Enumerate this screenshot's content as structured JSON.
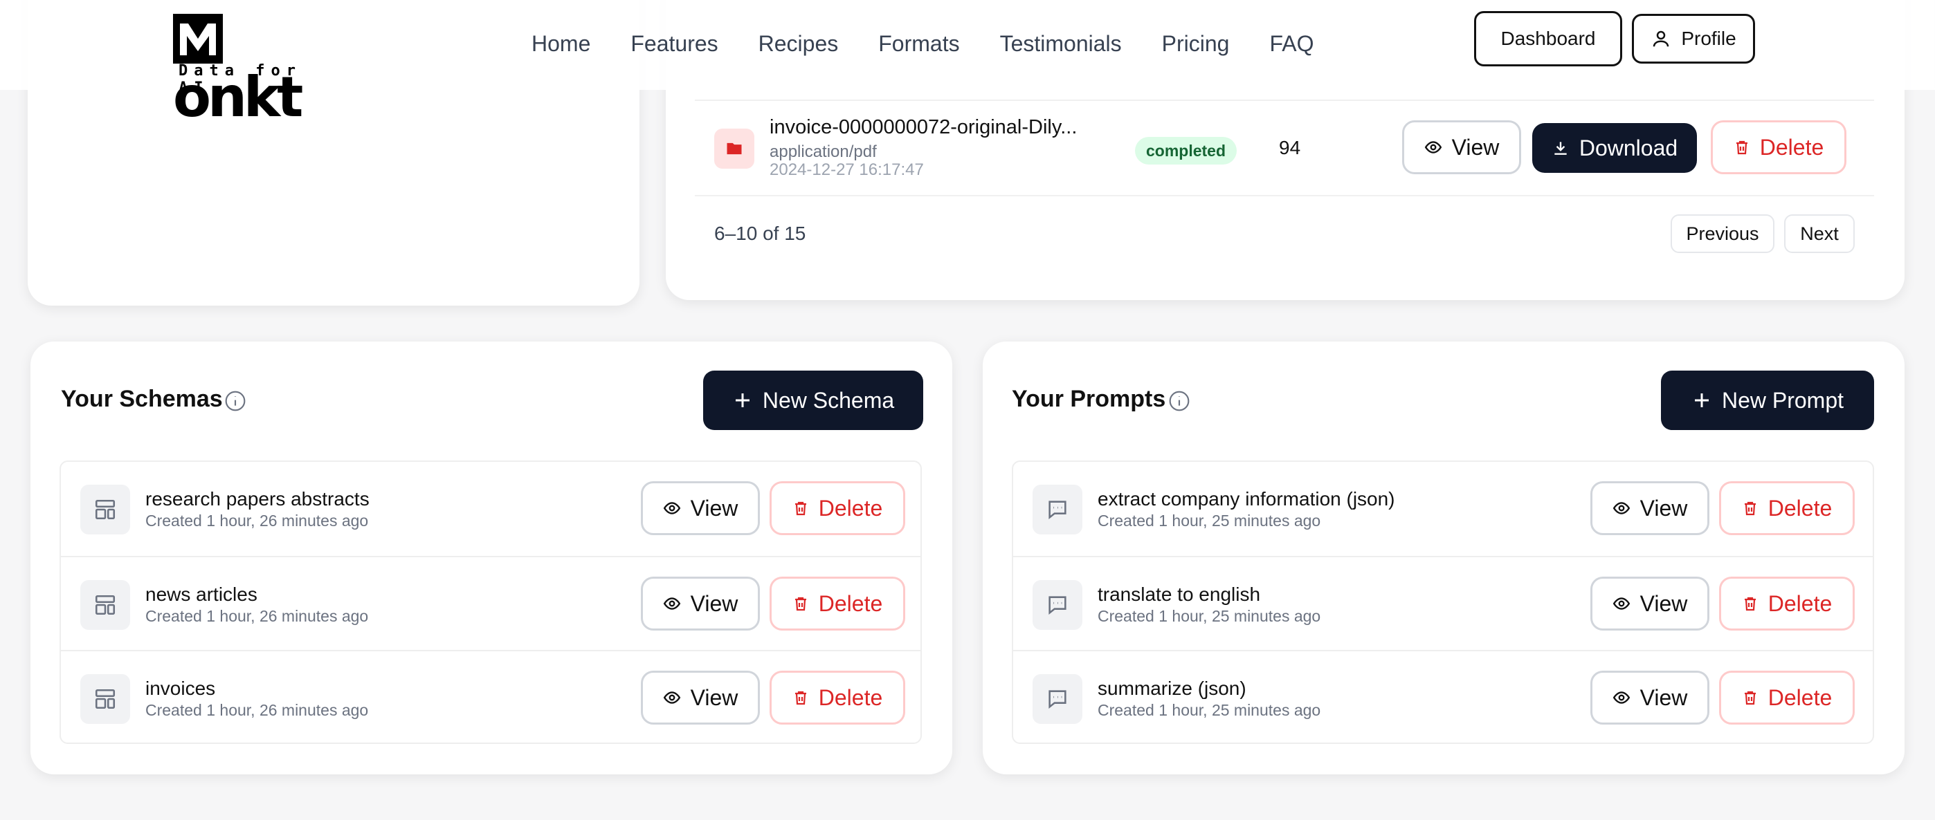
{
  "header": {
    "logo_word": "onkt",
    "logo_m": "M",
    "logo_tagline": "Data for AI",
    "nav": [
      "Home",
      "Features",
      "Recipes",
      "Formats",
      "Testimonials",
      "Pricing",
      "FAQ"
    ],
    "dashboard_label": "Dashboard",
    "profile_label": "Profile"
  },
  "documents": {
    "row": {
      "name": "invoice-0000000072-original-Dily...",
      "mime": "application/pdf",
      "date": "2024-12-27 16:17:47",
      "status": "completed",
      "count": "94",
      "view_label": "View",
      "download_label": "Download",
      "delete_label": "Delete"
    },
    "pagination": {
      "range": "6–10 of 15",
      "previous": "Previous",
      "next": "Next"
    }
  },
  "schemas": {
    "title": "Your Schemas",
    "new_label": "New Schema",
    "items": [
      {
        "name": "research papers abstracts",
        "created": "Created 1 hour, 26 minutes ago"
      },
      {
        "name": "news articles",
        "created": "Created 1 hour, 26 minutes ago"
      },
      {
        "name": "invoices",
        "created": "Created 1 hour, 26 minutes ago"
      }
    ],
    "view_label": "View",
    "delete_label": "Delete"
  },
  "prompts": {
    "title": "Your Prompts",
    "new_label": "New Prompt",
    "items": [
      {
        "name": "extract company information (json)",
        "created": "Created 1 hour, 25 minutes ago"
      },
      {
        "name": "translate to english",
        "created": "Created 1 hour, 25 minutes ago"
      },
      {
        "name": "summarize (json)",
        "created": "Created 1 hour, 25 minutes ago"
      }
    ],
    "view_label": "View",
    "delete_label": "Delete"
  },
  "colors": {
    "accent_dark": "#0f172a",
    "danger": "#dc2626",
    "success_bg": "#dcfce7"
  }
}
